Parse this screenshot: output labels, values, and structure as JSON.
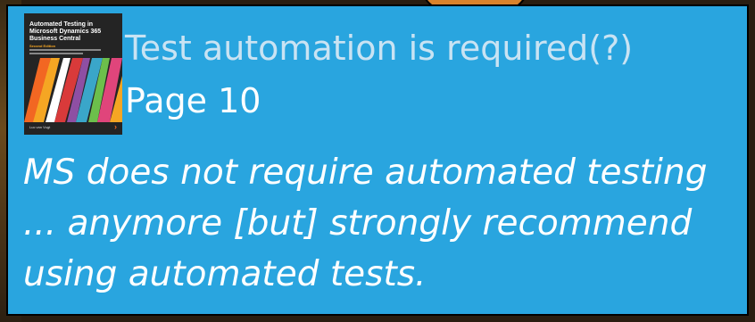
{
  "slide": {
    "title": "Test automation is required(?)",
    "page_ref": "Page 10",
    "quote": "MS does not require automated testing ... anymore [but] strongly recommend using automated tests."
  },
  "book_cover": {
    "title": "Automated Testing in Microsoft Dynamics 365 Business Central",
    "edition": "Second Edition",
    "author": "Luc van Vugt",
    "logo": "›",
    "colors": [
      "#f26722",
      "#f5a623",
      "#d93a3a",
      "#8e4fa3",
      "#3aa6c9",
      "#6cbf4b",
      "#ffffff",
      "#e0457b"
    ]
  },
  "colors": {
    "panel": "#29a5df",
    "title_text": "#c9e3f3",
    "body_text": "#ffffff"
  }
}
